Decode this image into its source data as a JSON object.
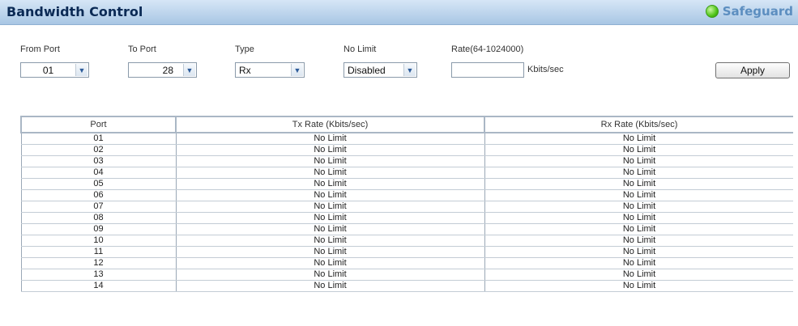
{
  "header": {
    "title": "Bandwidth Control",
    "safeguard_label": "Safeguard",
    "status_color": "#4fc419"
  },
  "form": {
    "from_port": {
      "label": "From Port",
      "value": "01"
    },
    "to_port": {
      "label": "To Port",
      "value": "28"
    },
    "type": {
      "label": "Type",
      "value": "Rx"
    },
    "no_limit": {
      "label": "No Limit",
      "value": "Disabled"
    },
    "rate": {
      "label": "Rate(64-1024000)",
      "value": "",
      "unit": "Kbits/sec"
    },
    "apply_label": "Apply"
  },
  "table": {
    "headers": [
      "Port",
      "Tx Rate (Kbits/sec)",
      "Rx Rate (Kbits/sec)"
    ],
    "rows": [
      [
        "01",
        "No Limit",
        "No Limit"
      ],
      [
        "02",
        "No Limit",
        "No Limit"
      ],
      [
        "03",
        "No Limit",
        "No Limit"
      ],
      [
        "04",
        "No Limit",
        "No Limit"
      ],
      [
        "05",
        "No Limit",
        "No Limit"
      ],
      [
        "06",
        "No Limit",
        "No Limit"
      ],
      [
        "07",
        "No Limit",
        "No Limit"
      ],
      [
        "08",
        "No Limit",
        "No Limit"
      ],
      [
        "09",
        "No Limit",
        "No Limit"
      ],
      [
        "10",
        "No Limit",
        "No Limit"
      ],
      [
        "11",
        "No Limit",
        "No Limit"
      ],
      [
        "12",
        "No Limit",
        "No Limit"
      ],
      [
        "13",
        "No Limit",
        "No Limit"
      ],
      [
        "14",
        "No Limit",
        "No Limit"
      ]
    ]
  }
}
